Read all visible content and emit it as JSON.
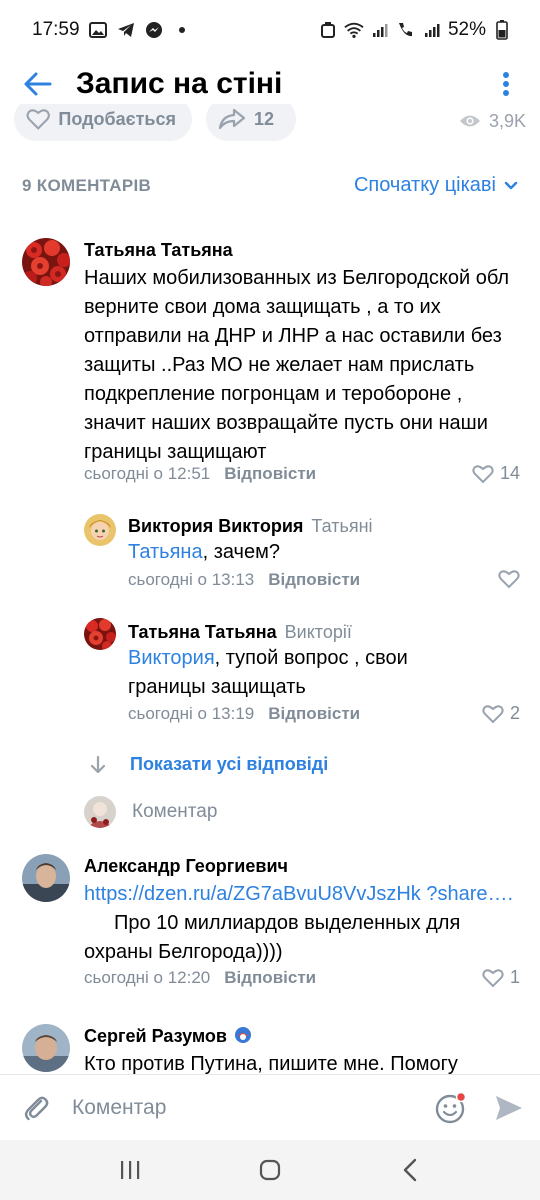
{
  "status_bar": {
    "time": "17:59",
    "battery": "52%"
  },
  "header": {
    "title": "Запис на стіні"
  },
  "post_actions": {
    "like_label": "Подобається",
    "share_count": "12",
    "views": "3,9K"
  },
  "comments_section": {
    "count_label": "9 КОМЕНТАРІВ",
    "sort_label": "Спочатку цікаві"
  },
  "comments": [
    {
      "author": "Татьяна Татьяна",
      "text": "Наших мобилизованных из Белгородской обл верните свои дома защищать , а то их отправили на ДНР и ЛНР а нас оставили без защиты ..Раз  МО не желает нам прислать подкрепление погронцам и теробороне , значит наших возвращайте пусть они наши границы защищают",
      "time": "сьогодні о 12:51",
      "reply_label": "Відповісти",
      "likes": "14"
    },
    {
      "author": "Виктория Виктория",
      "reply_to": "Татьяні",
      "mention": "Татьяна",
      "text": ", зачем?",
      "time": "сьогодні о 13:13",
      "reply_label": "Відповісти",
      "likes": ""
    },
    {
      "author": "Татьяна Татьяна",
      "reply_to": "Викторії",
      "mention": "Виктория",
      "text": ", тупой вопрос , свои границы защищать",
      "time": "сьогодні о 13:19",
      "reply_label": "Відповісти",
      "likes": "2"
    },
    {
      "author": "Александр Георгиевич",
      "link": "https://dzen.ru/a/ZG7aBvuU8VvJszHk ?share….",
      "text": "Про 10 миллиардов выделенных для охраны Белгорода))))",
      "time": "сьогодні о 12:20",
      "reply_label": "Відповісти",
      "likes": "1"
    },
    {
      "author": "Сергей Разумов",
      "text": "Кто против Путина, пишите мне.  Помогу"
    }
  ],
  "show_all_replies": "Показати усі відповіді",
  "inline_comment_placeholder": "Коментар",
  "input": {
    "placeholder": "Коментар"
  },
  "colors": {
    "accent": "#2d81e0",
    "secondary_text": "#818c99",
    "pill_bg": "#f0f2f5",
    "notification_dot": "#e64646"
  }
}
